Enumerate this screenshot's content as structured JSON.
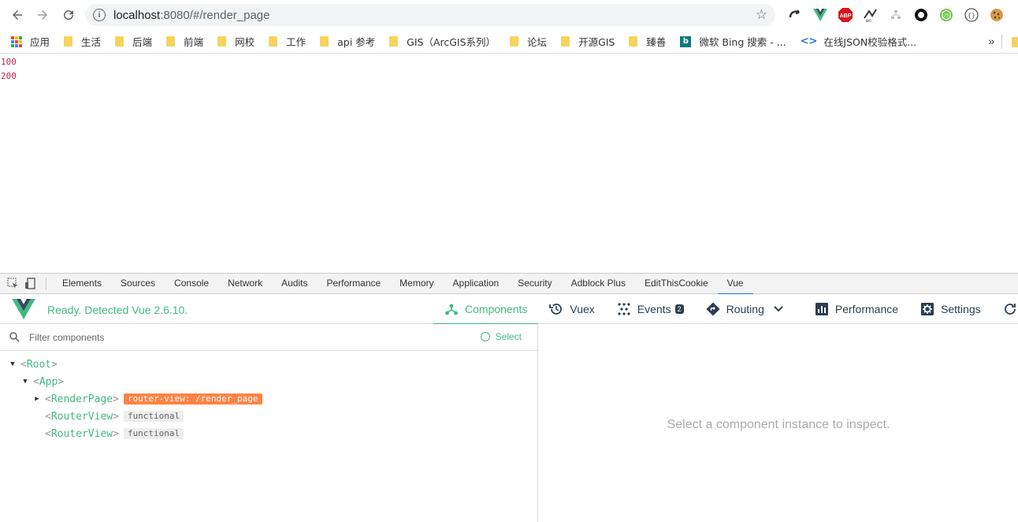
{
  "browser": {
    "url_host": "localhost",
    "url_rest": ":8080/#/render_page"
  },
  "bookmarks": [
    {
      "label": "应用",
      "icon": "apps-grid-icon"
    },
    {
      "label": "生活",
      "icon": "folder-icon"
    },
    {
      "label": "后端",
      "icon": "folder-icon"
    },
    {
      "label": "前端",
      "icon": "folder-icon"
    },
    {
      "label": "网校",
      "icon": "folder-icon"
    },
    {
      "label": "工作",
      "icon": "folder-icon"
    },
    {
      "label": "api 参考",
      "icon": "folder-icon"
    },
    {
      "label": "GIS（ArcGIS系列）",
      "icon": "folder-icon"
    },
    {
      "label": "论坛",
      "icon": "folder-icon"
    },
    {
      "label": "开源GIS",
      "icon": "folder-icon"
    },
    {
      "label": "臻善",
      "icon": "folder-icon"
    },
    {
      "label": "微软 Bing 搜索 - ...",
      "icon": "bing-icon"
    },
    {
      "label": "在线JSON校验格式...",
      "icon": "json-icon"
    }
  ],
  "bookmarks_more": "»",
  "page": {
    "lines": [
      "100",
      "200"
    ]
  },
  "devtools": {
    "tabs": [
      "Elements",
      "Sources",
      "Console",
      "Network",
      "Audits",
      "Performance",
      "Memory",
      "Application",
      "Security",
      "Adblock Plus",
      "EditThisCookie",
      "Vue"
    ],
    "active_tab": "Vue"
  },
  "vue": {
    "status": "Ready. Detected Vue 2.6.10.",
    "nav": {
      "components": "Components",
      "vuex": "Vuex",
      "events": "Events",
      "events_badge": "2",
      "routing": "Routing",
      "performance": "Performance",
      "settings": "Settings"
    },
    "filter_placeholder": "Filter components",
    "select_label": "Select",
    "tree": {
      "root": "Root",
      "app": "App",
      "render_page": "RenderPage",
      "render_page_tag": "router-view: /render_page",
      "router_view_1": "RouterView",
      "router_view_2": "RouterView",
      "functional_tag": "functional"
    },
    "inspect_placeholder": "Select a component instance to inspect."
  },
  "colors": {
    "vue_green": "#42b983",
    "tag_orange": "#ff8344",
    "active_tab_blue": "#1a73e8"
  }
}
